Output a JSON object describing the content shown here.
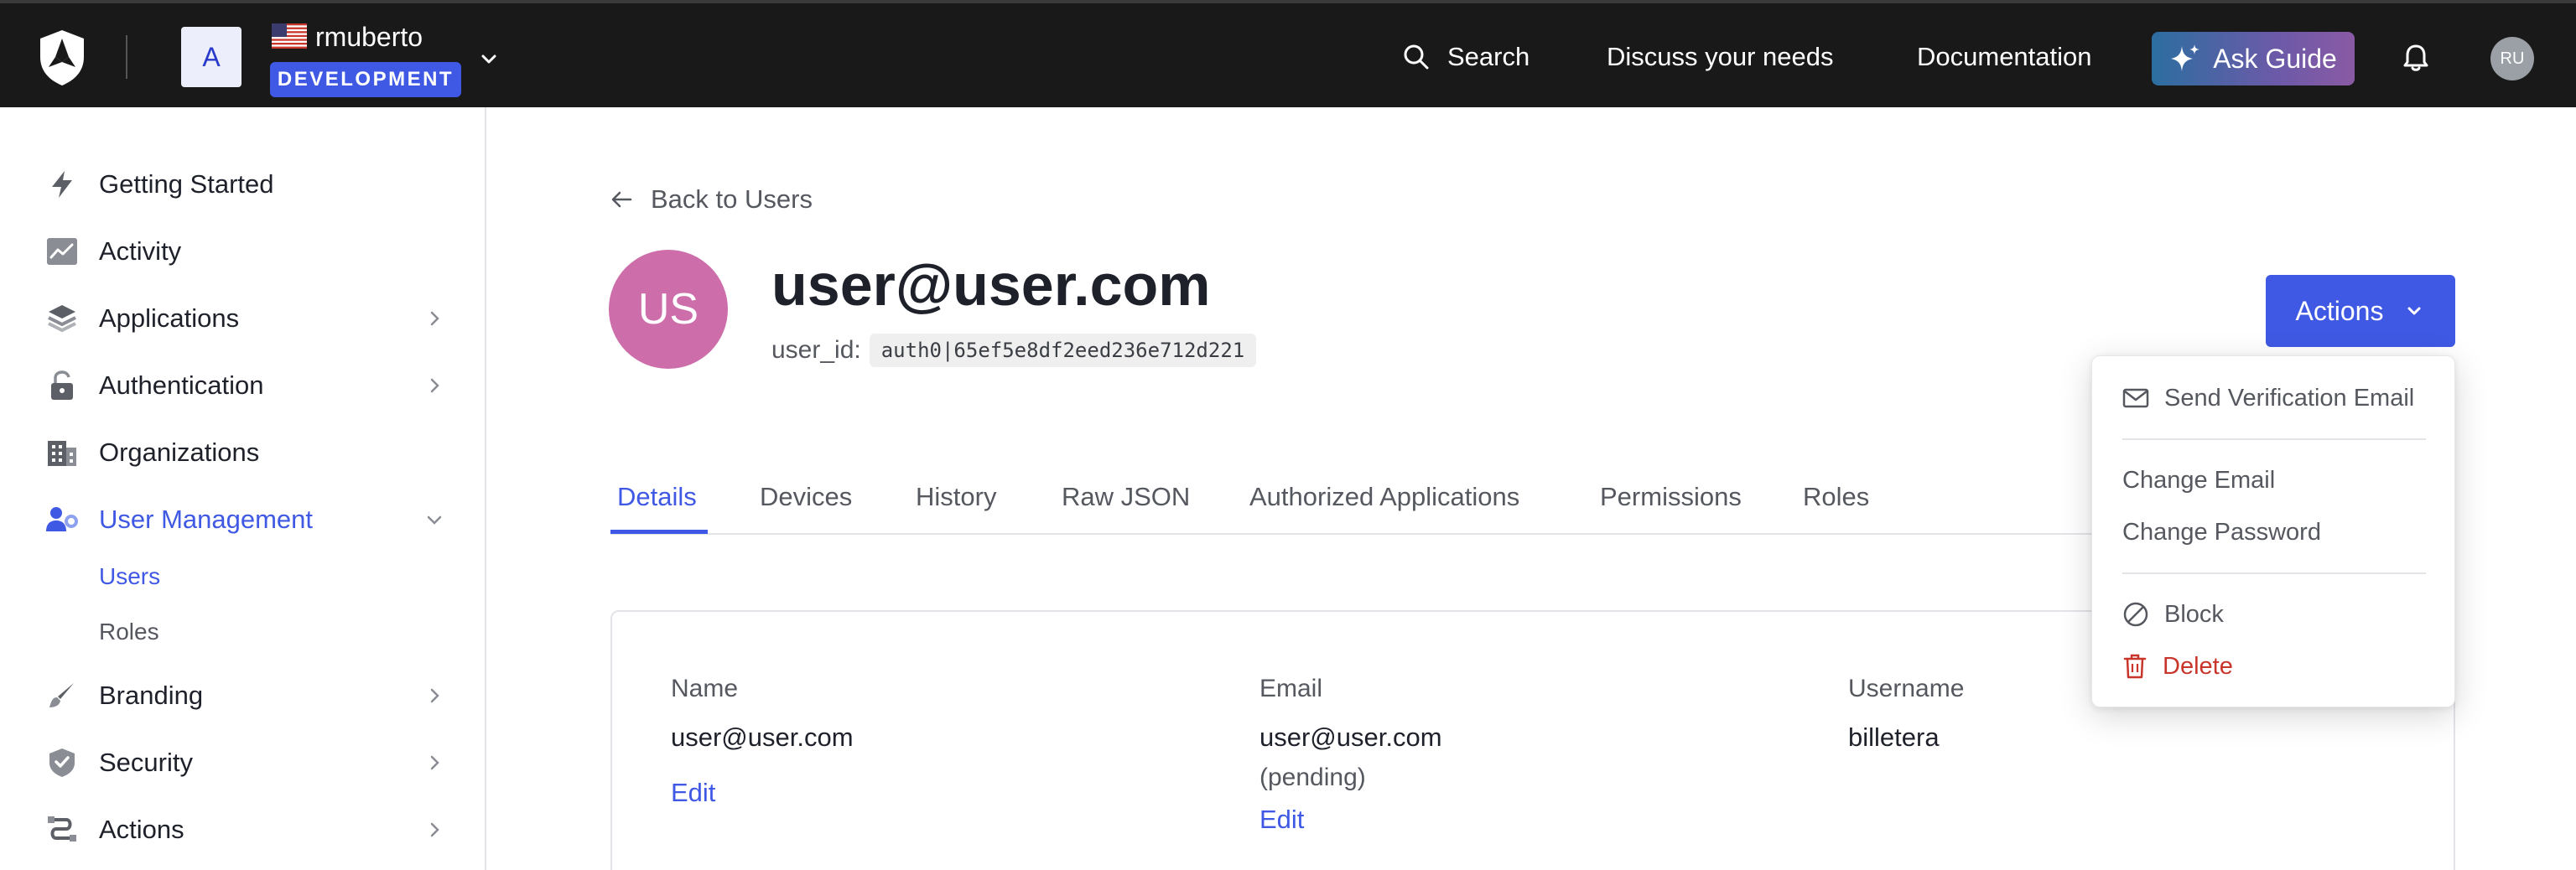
{
  "topbar": {
    "tenant_initial": "A",
    "tenant_name": "rmuberto",
    "environment": "DEVELOPMENT",
    "search_label": "Search",
    "discuss_label": "Discuss your needs",
    "docs_label": "Documentation",
    "ask_guide_label": "Ask Guide",
    "user_initials": "RU"
  },
  "sidebar": {
    "items": [
      {
        "label": "Getting Started",
        "icon": "lightning-icon"
      },
      {
        "label": "Activity",
        "icon": "activity-chart-icon"
      },
      {
        "label": "Applications",
        "icon": "layers-icon"
      },
      {
        "label": "Authentication",
        "icon": "lock-icon"
      },
      {
        "label": "Organizations",
        "icon": "building-icon"
      },
      {
        "label": "User Management",
        "icon": "users-gear-icon"
      },
      {
        "label": "Branding",
        "icon": "brush-icon"
      },
      {
        "label": "Security",
        "icon": "shield-check-icon"
      },
      {
        "label": "Actions",
        "icon": "flow-icon"
      }
    ],
    "sub_items": [
      {
        "label": "Users"
      },
      {
        "label": "Roles"
      }
    ]
  },
  "main": {
    "back_label": "Back to Users",
    "avatar_initials": "US",
    "title": "user@user.com",
    "user_id_label": "user_id:",
    "user_id_value": "auth0|65ef5e8df2eed236e712d221",
    "actions_label": "Actions",
    "tabs": [
      {
        "label": "Details"
      },
      {
        "label": "Devices"
      },
      {
        "label": "History"
      },
      {
        "label": "Raw JSON"
      },
      {
        "label": "Authorized Applications"
      },
      {
        "label": "Permissions"
      },
      {
        "label": "Roles"
      }
    ],
    "fields": {
      "name": {
        "label": "Name",
        "value": "user@user.com",
        "edit": "Edit"
      },
      "email": {
        "label": "Email",
        "value": "user@user.com",
        "note": "(pending)",
        "edit": "Edit"
      },
      "username": {
        "label": "Username",
        "value": "billetera"
      }
    }
  },
  "dropdown": {
    "send_verification": "Send Verification Email",
    "change_email": "Change Email",
    "change_password": "Change Password",
    "block": "Block",
    "delete": "Delete"
  },
  "colors": {
    "accent": "#3f59e4",
    "topbar_bg": "#191919",
    "danger": "#c8352a",
    "avatar_pink": "#cd6daa"
  }
}
